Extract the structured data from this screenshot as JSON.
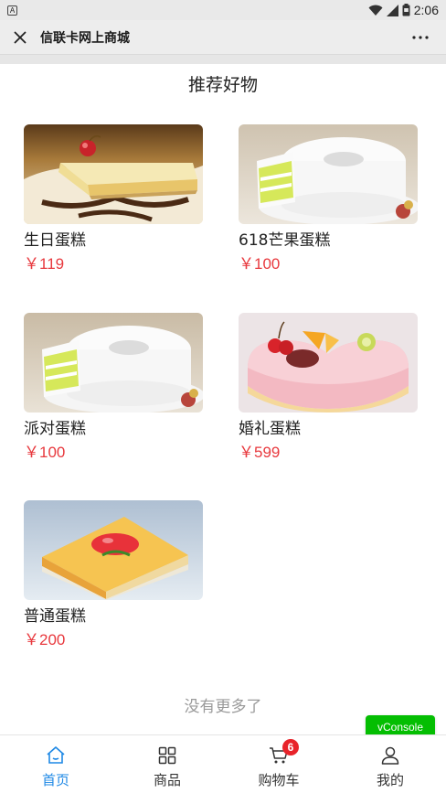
{
  "status_bar": {
    "left_badge": "A",
    "time": "2:06"
  },
  "title_bar": {
    "title": "信联卡网上商城"
  },
  "section": {
    "title": "推荐好物"
  },
  "products": [
    {
      "name": "生日蛋糕",
      "price": "￥119",
      "image": "birthday-cake-slice"
    },
    {
      "name": "618芒果蛋糕",
      "price": "￥100",
      "image": "mango-cake"
    },
    {
      "name": "派对蛋糕",
      "price": "￥100",
      "image": "party-cake"
    },
    {
      "name": "婚礼蛋糕",
      "price": "￥599",
      "image": "heart-cake"
    },
    {
      "name": "普通蛋糕",
      "price": "￥200",
      "image": "strawberry-cake-slice"
    }
  ],
  "footer_text": "没有更多了",
  "vconsole": {
    "label": "vConsole",
    "color": "#04be02"
  },
  "tabbar": {
    "items": [
      {
        "label": "首页",
        "icon": "home-icon",
        "active": true
      },
      {
        "label": "商品",
        "icon": "grid-icon",
        "active": false
      },
      {
        "label": "购物车",
        "icon": "cart-icon",
        "active": false,
        "badge": "6"
      },
      {
        "label": "我的",
        "icon": "user-icon",
        "active": false
      }
    ],
    "active_color": "#1e88e5"
  },
  "colors": {
    "price": "#e8393e",
    "badge": "#e8232a"
  }
}
